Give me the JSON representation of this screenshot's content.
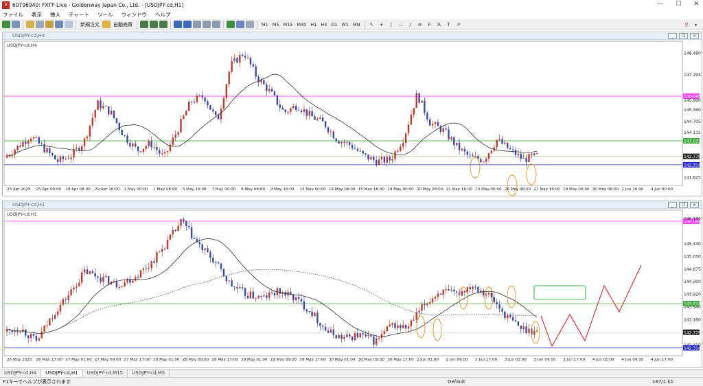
{
  "window": {
    "title": "607969­40: FXTF-Live - Goldenway Japan Co., Ltd. - [USDJPY-cd,H1]"
  },
  "menu": [
    "ファイル",
    "表示",
    "挿入",
    "チャート",
    "ツール",
    "ウィンドウ",
    "ヘルプ"
  ],
  "toolbar": {
    "new_order": "新規注文",
    "auto_trade": "自動売買",
    "timeframes": [
      "M1",
      "M5",
      "M15",
      "M30",
      "H1",
      "H4",
      "D1",
      "W1",
      "MN"
    ]
  },
  "chart1": {
    "window_title": "USDJPY-cd,H4",
    "label": "USDJPY-cd,H4",
    "price_labels": [
      {
        "text": "148.480",
        "price": 148.48
      },
      {
        "text": "147.295",
        "price": 147.295
      },
      {
        "text": "146.095",
        "price": 146.095,
        "style": "magenta"
      },
      {
        "text": "145.890",
        "price": 145.89
      },
      {
        "text": "145.360",
        "price": 145.36
      },
      {
        "text": "144.705",
        "price": 144.705
      },
      {
        "text": "144.115",
        "price": 144.115
      },
      {
        "text": "143.633",
        "price": 143.633,
        "style": "green"
      },
      {
        "text": "142.779",
        "price": 142.779,
        "style": "dark"
      },
      {
        "text": "142.314",
        "price": 142.314,
        "style": "blue"
      },
      {
        "text": "141.625",
        "price": 141.625
      }
    ],
    "time_labels": [
      "23 Apr 2025",
      "25 Apr 00:00",
      "28 Apr 08:00",
      "29 Apr 16:00",
      "1 May 00:00",
      "2 May 08:00",
      "5 May 16:00",
      "7 May 00:00",
      "8 May 08:00",
      "9 May 16:00",
      "13 May 00:00",
      "14 May 08:00",
      "15 May 16:00",
      "19 May 00:00",
      "20 May 08:00",
      "21 May 16:00",
      "23 May 00:00",
      "26 May 08:00",
      "27 May 16:00",
      "29 May 00:00",
      "30 May 08:00",
      "2 Jun 16:00",
      "4 Jun 00:00"
    ]
  },
  "chart2": {
    "window_title": "USDJPY-cd,H1",
    "label": "USDJPY-cd,H1",
    "price_labels": [
      {
        "text": "146.095",
        "price": 146.095,
        "style": "magenta"
      },
      {
        "text": "146.180",
        "price": 146.18
      },
      {
        "text": "145.430",
        "price": 145.43
      },
      {
        "text": "145.050",
        "price": 145.05
      },
      {
        "text": "144.675",
        "price": 144.675
      },
      {
        "text": "144.300",
        "price": 144.3
      },
      {
        "text": "143.920",
        "price": 143.92
      },
      {
        "text": "143.633",
        "price": 143.633,
        "style": "green"
      },
      {
        "text": "143.540",
        "price": 143.54
      },
      {
        "text": "143.160",
        "price": 143.16
      },
      {
        "text": "142.779",
        "price": 142.779,
        "style": "dark"
      },
      {
        "text": "142.410",
        "price": 142.41
      },
      {
        "text": "142.314",
        "price": 142.314,
        "style": "blue"
      }
    ],
    "time_labels": [
      "26 May 2025",
      "26 May 17:00",
      "27 May 01:00",
      "27 May 09:00",
      "27 May 17:00",
      "28 May 01:00",
      "28 May 09:00",
      "28 May 17:00",
      "29 May 01:00",
      "29 May 09:00",
      "29 May 17:00",
      "30 May 01:00",
      "30 May 09:00",
      "30 May 17:00",
      "2 Jun 01:00",
      "2 Jun 09:00",
      "2 Jun 17:00",
      "3 Jun 01:00",
      "3 Jun 09:00",
      "3 Jun 17:00",
      "4 Jun 01:00",
      "4 Jun 09:00",
      "4 Jun 17:00"
    ]
  },
  "tabs": [
    "USDJPY-cd,H4",
    "USDJPY-cd,H1",
    "USDJPY-cd,M15",
    "USDJPY-cd,M5"
  ],
  "active_tab": "USDJPY-cd,H1",
  "status": {
    "help": "F1キーでヘルプが表示されます",
    "profile": "Default",
    "connection": "167/1 kb"
  },
  "colors": {
    "bull": "#2f9a2f",
    "bear": "#c0392b",
    "candle_up": "#c0392b",
    "candle_down": "#3949ab",
    "magenta": "#ff44ff",
    "green": "#3aaa3a",
    "blue": "#2b2bcc",
    "orange": "#e8901a",
    "forecast": "#e02020",
    "box": "#3ab84a"
  }
}
